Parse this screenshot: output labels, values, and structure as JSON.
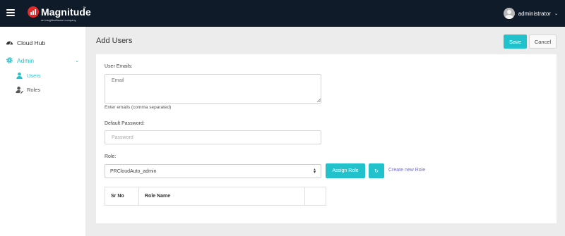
{
  "topbar": {
    "logo_text": "Magnitude",
    "logo_tm": "™",
    "logo_sub": "an insightsoftware company",
    "user_name": "administrator",
    "user_caret": "⌄"
  },
  "sidebar": {
    "items": [
      {
        "label": "Cloud Hub",
        "icon": "dashboard-icon"
      },
      {
        "label": "Admin",
        "icon": "gear-icon",
        "expanded": true,
        "chevron": "⌄"
      },
      {
        "label": "Users",
        "icon": "user-icon",
        "active": true
      },
      {
        "label": "Roles",
        "icon": "user-edit-icon"
      }
    ]
  },
  "page": {
    "title": "Add Users",
    "save_label": "Save",
    "cancel_label": "Cancel"
  },
  "form": {
    "emails_label": "User Emails:",
    "emails_placeholder": "Email",
    "emails_hint": "Enter emails (comma separated)",
    "password_label": "Default Password:",
    "password_placeholder": "Password",
    "role_label": "Role:",
    "role_selected": "PRCloudAuto_admin",
    "assign_label": "Assign Role",
    "refresh_glyph": "↻",
    "create_role_label": "Create new Role"
  },
  "table": {
    "headers": [
      "Sr No",
      "Role Name",
      ""
    ]
  },
  "colors": {
    "topbar": "#0f1b29",
    "accent": "#22c2cc",
    "brand_red": "#e42a2a",
    "link": "#6e6ad8"
  }
}
